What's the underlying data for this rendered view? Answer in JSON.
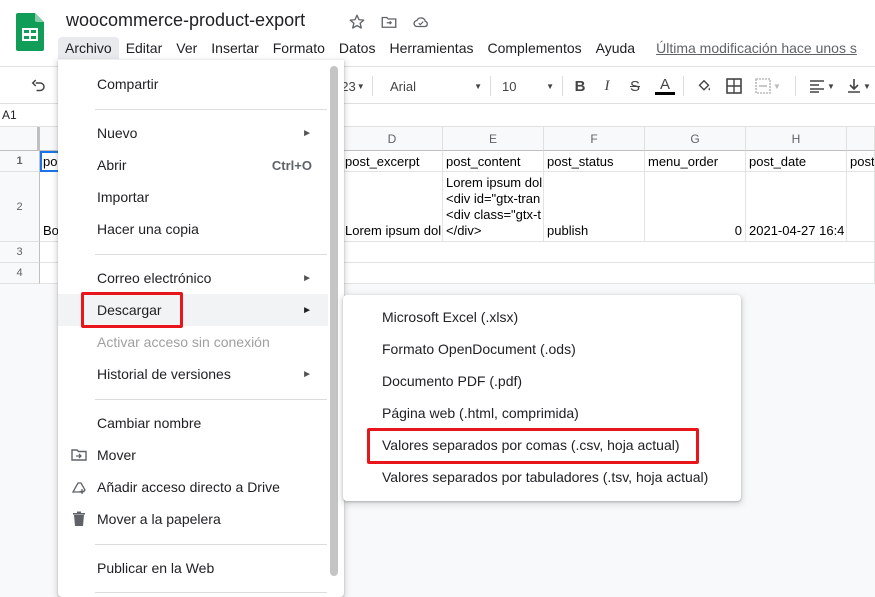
{
  "app": {
    "doc_title": "woocommerce-product-export",
    "brand_color": "#0f9d58",
    "icons": [
      "star-icon",
      "move-to-folder-icon",
      "cloud-status-icon"
    ]
  },
  "menubar": {
    "items": [
      "Archivo",
      "Editar",
      "Ver",
      "Insertar",
      "Formato",
      "Datos",
      "Herramientas",
      "Complementos",
      "Ayuda"
    ],
    "last_modified": "Última modificación hace unos s"
  },
  "toolbar": {
    "number_format": "23",
    "font": "Arial",
    "font_size": "10",
    "buttons": [
      "undo-icon",
      "bold-icon",
      "italic-icon",
      "strikethrough-icon",
      "text-color-icon",
      "fill-color-icon",
      "borders-icon",
      "merge-cells-icon",
      "align-horizontal-icon",
      "align-vertical-icon"
    ],
    "bold_label": "B",
    "italic_label": "I",
    "strike_label": "S",
    "text_color_label": "A"
  },
  "formula_bar": {
    "cell_ref": "A1"
  },
  "grid": {
    "columns": [
      "D",
      "E",
      "F",
      "G",
      "H"
    ],
    "rows": [
      "1",
      "2",
      "3",
      "4"
    ],
    "row1": [
      "po",
      "post_excerpt",
      "post_content",
      "post_status",
      "menu_order",
      "post_date",
      "post"
    ],
    "row2": {
      "a": "Bo",
      "excerpt": "Lorem ipsum dol",
      "content_lines": [
        "Lorem ipsum dol",
        "<div id=\"gtx-tran",
        "<div class=\"gtx-t",
        "</div>"
      ],
      "status": "publish",
      "menu_order": "0",
      "date": "2021-04-27 16:4"
    }
  },
  "file_menu": {
    "items": [
      {
        "label": "Compartir"
      },
      {
        "label": "Nuevo",
        "submenu": true
      },
      {
        "label": "Abrir",
        "shortcut": "Ctrl+O"
      },
      {
        "label": "Importar"
      },
      {
        "label": "Hacer una copia"
      },
      {
        "label": "Correo electrónico",
        "submenu": true
      },
      {
        "label": "Descargar",
        "submenu": true,
        "active": true
      },
      {
        "label": "Activar acceso sin conexión",
        "disabled": true
      },
      {
        "label": "Historial de versiones",
        "submenu": true
      },
      {
        "label": "Cambiar nombre"
      },
      {
        "label": "Mover",
        "icon": "move-folder-icon"
      },
      {
        "label": "Añadir acceso directo a Drive",
        "icon": "add-shortcut-icon"
      },
      {
        "label": "Mover a la papelera",
        "icon": "trash-icon"
      },
      {
        "label": "Publicar en la Web"
      }
    ],
    "arrow": "►"
  },
  "download_submenu": {
    "items": [
      "Microsoft Excel (.xlsx)",
      "Formato OpenDocument (.ods)",
      "Documento PDF (.pdf)",
      "Página web (.html, comprimida)",
      "Valores separados por comas (.csv, hoja actual)",
      "Valores separados por tabuladores (.tsv, hoja actual)"
    ]
  },
  "highlight_color": "#e8161b"
}
